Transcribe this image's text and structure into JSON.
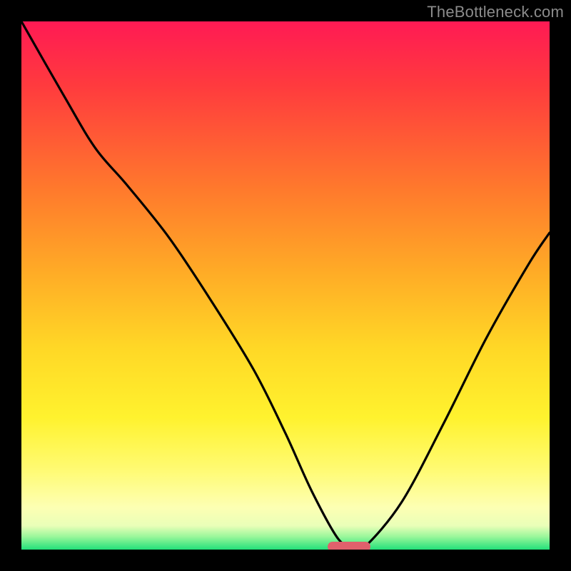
{
  "watermark": "TheBottleneck.com",
  "chart_data": {
    "type": "line",
    "title": "",
    "xlabel": "",
    "ylabel": "",
    "xlim": [
      0,
      100
    ],
    "ylim": [
      0,
      100
    ],
    "grid": false,
    "series": [
      {
        "name": "bottleneck-curve",
        "x": [
          0,
          8,
          14,
          20,
          28,
          36,
          44,
          50,
          55,
          60,
          63,
          65,
          72,
          80,
          88,
          96,
          100
        ],
        "values": [
          100,
          86,
          76,
          69,
          59,
          47,
          34,
          22,
          11,
          2,
          0.5,
          0.5,
          9,
          24,
          40,
          54,
          60
        ]
      }
    ],
    "annotations": [
      {
        "name": "optimal-marker",
        "x": 62,
        "y": 0.5,
        "shape": "pill",
        "color": "#e0606c"
      }
    ],
    "background_gradient": {
      "direction": "vertical",
      "stops": [
        {
          "pos": 0,
          "color": "#ff1a54"
        },
        {
          "pos": 0.32,
          "color": "#ff7a2c"
        },
        {
          "pos": 0.62,
          "color": "#ffd826"
        },
        {
          "pos": 0.85,
          "color": "#fffb74"
        },
        {
          "pos": 0.96,
          "color": "#9cf79b"
        },
        {
          "pos": 1.0,
          "color": "#22e07a"
        }
      ]
    }
  }
}
